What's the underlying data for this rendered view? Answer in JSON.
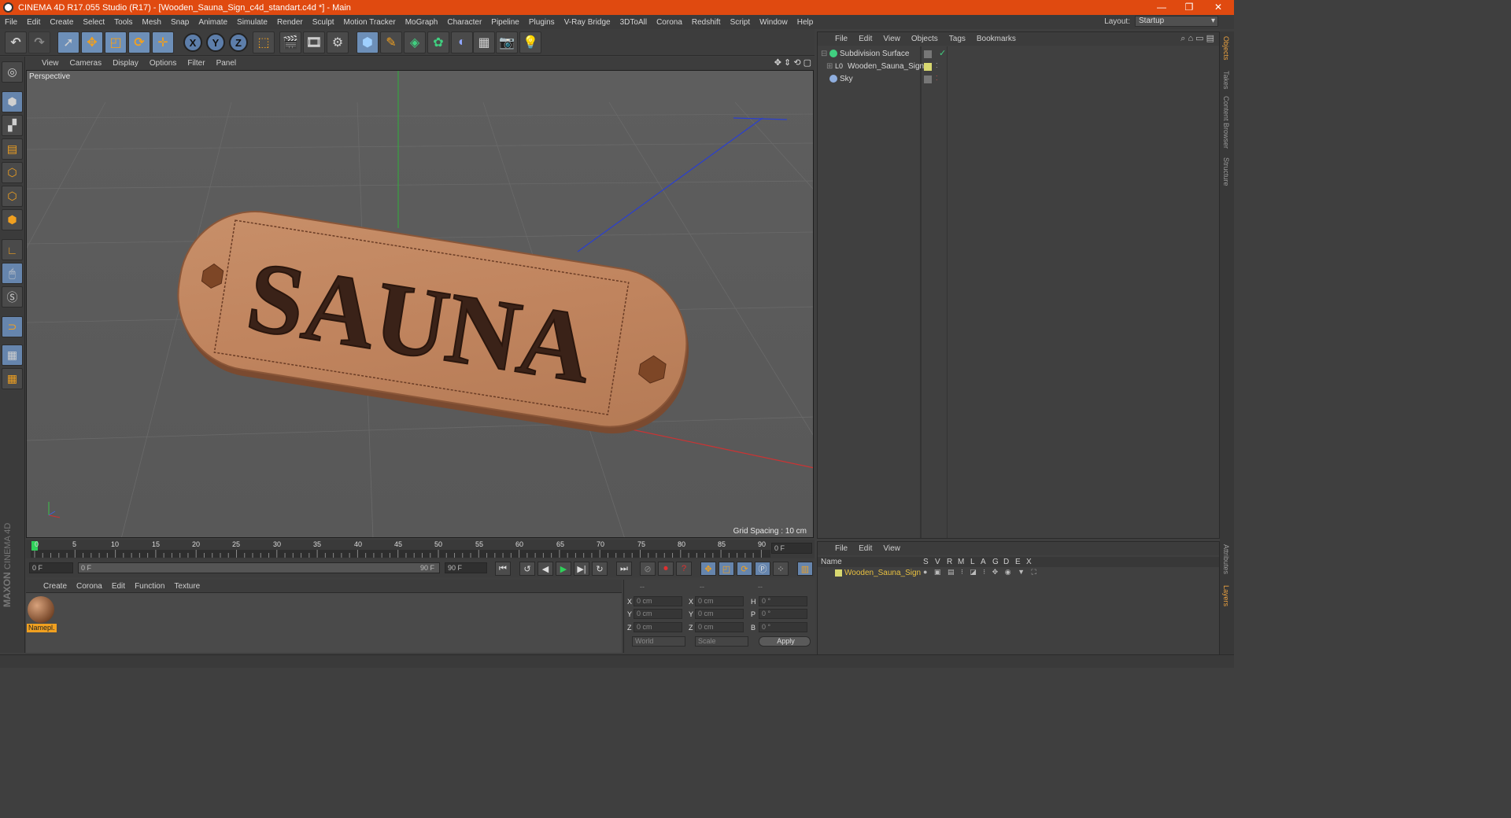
{
  "window": {
    "title": "CINEMA 4D R17.055 Studio (R17) - [Wooden_Sauna_Sign_c4d_standart.c4d *] - Main"
  },
  "menubar": {
    "items": [
      "File",
      "Edit",
      "Create",
      "Select",
      "Tools",
      "Mesh",
      "Snap",
      "Animate",
      "Simulate",
      "Render",
      "Sculpt",
      "Motion Tracker",
      "MoGraph",
      "Character",
      "Pipeline",
      "Plugins",
      "V-Ray Bridge",
      "3DToAll",
      "Corona",
      "Redshift",
      "Script",
      "Window",
      "Help"
    ],
    "layout_label": "Layout:",
    "layout_value": "Startup"
  },
  "toolbar": {
    "axis_x": "X",
    "axis_y": "Y",
    "axis_z": "Z"
  },
  "viewport": {
    "menu": [
      "View",
      "Cameras",
      "Display",
      "Options",
      "Filter",
      "Panel"
    ],
    "label": "Perspective",
    "grid_spacing": "Grid Spacing : 10 cm",
    "sign_text": "SAUNA"
  },
  "timeline": {
    "ticks": [
      "0",
      "5",
      "10",
      "15",
      "20",
      "25",
      "30",
      "35",
      "40",
      "45",
      "50",
      "55",
      "60",
      "65",
      "70",
      "75",
      "80",
      "85",
      "90"
    ],
    "current_frame": "0 F",
    "start_field": "0 F",
    "slider_start": "0 F",
    "slider_end": "90 F",
    "end_field": "90 F"
  },
  "material_manager": {
    "menu": [
      "Create",
      "Corona",
      "Edit",
      "Function",
      "Texture"
    ],
    "material_name": "Namepl."
  },
  "coordinates": {
    "headers": [
      "--",
      "--",
      "--"
    ],
    "rows": [
      {
        "l1": "X",
        "v1": "0 cm",
        "l2": "X",
        "v2": "0 cm",
        "l3": "H",
        "v3": "0 °"
      },
      {
        "l1": "Y",
        "v1": "0 cm",
        "l2": "Y",
        "v2": "0 cm",
        "l3": "P",
        "v3": "0 °"
      },
      {
        "l1": "Z",
        "v1": "0 cm",
        "l2": "Z",
        "v2": "0 cm",
        "l3": "B",
        "v3": "0 °"
      }
    ],
    "world": "World",
    "scale": "Scale",
    "apply": "Apply"
  },
  "object_manager": {
    "menu": [
      "File",
      "Edit",
      "View",
      "Objects",
      "Tags",
      "Bookmarks"
    ],
    "objects": [
      "Subdivision Surface",
      "Wooden_Sauna_Sign",
      "Sky"
    ]
  },
  "layer_manager": {
    "menu": [
      "File",
      "Edit",
      "View"
    ],
    "name_header": "Name",
    "columns": [
      "S",
      "V",
      "R",
      "M",
      "L",
      "A",
      "G",
      "D",
      "E",
      "X"
    ],
    "layer_name": "Wooden_Sauna_Sign"
  },
  "side_tabs": [
    "Objects",
    "Takes",
    "Content Browser",
    "Structure",
    "Attributes",
    "Layers"
  ],
  "brand": {
    "maxon": "MAXON",
    "c4d": "CINEMA 4D"
  }
}
